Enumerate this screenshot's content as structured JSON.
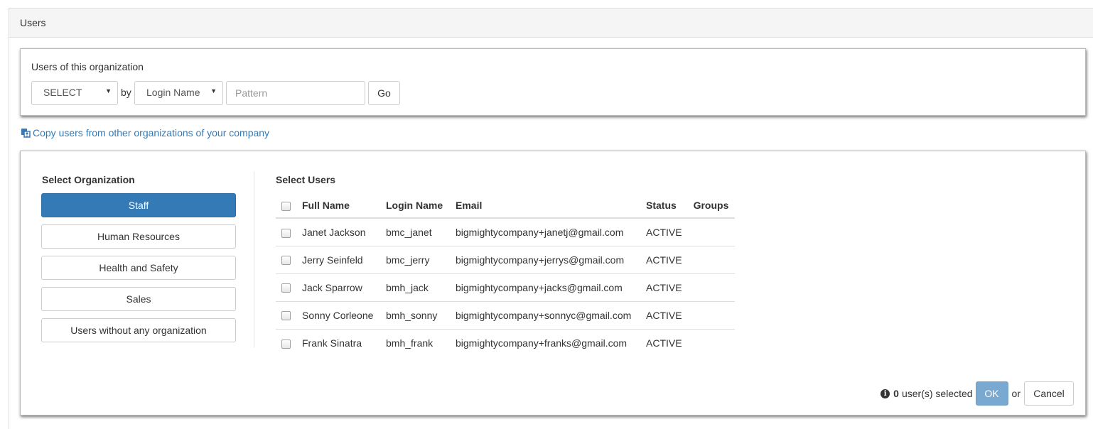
{
  "header": {
    "title": "Users"
  },
  "filter": {
    "label": "Users of this organization",
    "select_value": "SELECT",
    "by_text": "by",
    "field_value": "Login Name",
    "pattern_placeholder": "Pattern",
    "go_label": "Go"
  },
  "copy_link": {
    "label": "Copy users from other organizations of your company",
    "icon": "copy-users-icon"
  },
  "organizations": {
    "heading": "Select Organization",
    "items": [
      {
        "label": "Staff",
        "active": true
      },
      {
        "label": "Human Resources",
        "active": false
      },
      {
        "label": "Health and Safety",
        "active": false
      },
      {
        "label": "Sales",
        "active": false
      },
      {
        "label": "Users without any organization",
        "active": false
      }
    ]
  },
  "users": {
    "heading": "Select Users",
    "columns": [
      "Full Name",
      "Login Name",
      "Email",
      "Status",
      "Groups"
    ],
    "rows": [
      {
        "full_name": "Janet Jackson",
        "login": "bmc_janet",
        "email": "bigmightycompany+janetj@gmail.com",
        "status": "ACTIVE",
        "groups": ""
      },
      {
        "full_name": "Jerry Seinfeld",
        "login": "bmc_jerry",
        "email": "bigmightycompany+jerrys@gmail.com",
        "status": "ACTIVE",
        "groups": ""
      },
      {
        "full_name": "Jack Sparrow",
        "login": "bmh_jack",
        "email": "bigmightycompany+jacks@gmail.com",
        "status": "ACTIVE",
        "groups": ""
      },
      {
        "full_name": "Sonny Corleone",
        "login": "bmh_sonny",
        "email": "bigmightycompany+sonnyc@gmail.com",
        "status": "ACTIVE",
        "groups": ""
      },
      {
        "full_name": "Frank Sinatra",
        "login": "bmh_frank",
        "email": "bigmightycompany+franks@gmail.com",
        "status": "ACTIVE",
        "groups": ""
      }
    ]
  },
  "footer": {
    "count": "0",
    "selected_text": "user(s) selected",
    "ok_label": "OK",
    "or_text": "or",
    "cancel_label": "Cancel"
  },
  "colors": {
    "primary": "#337ab7",
    "link": "#337ab7",
    "header_bg": "#f5f5f5"
  }
}
